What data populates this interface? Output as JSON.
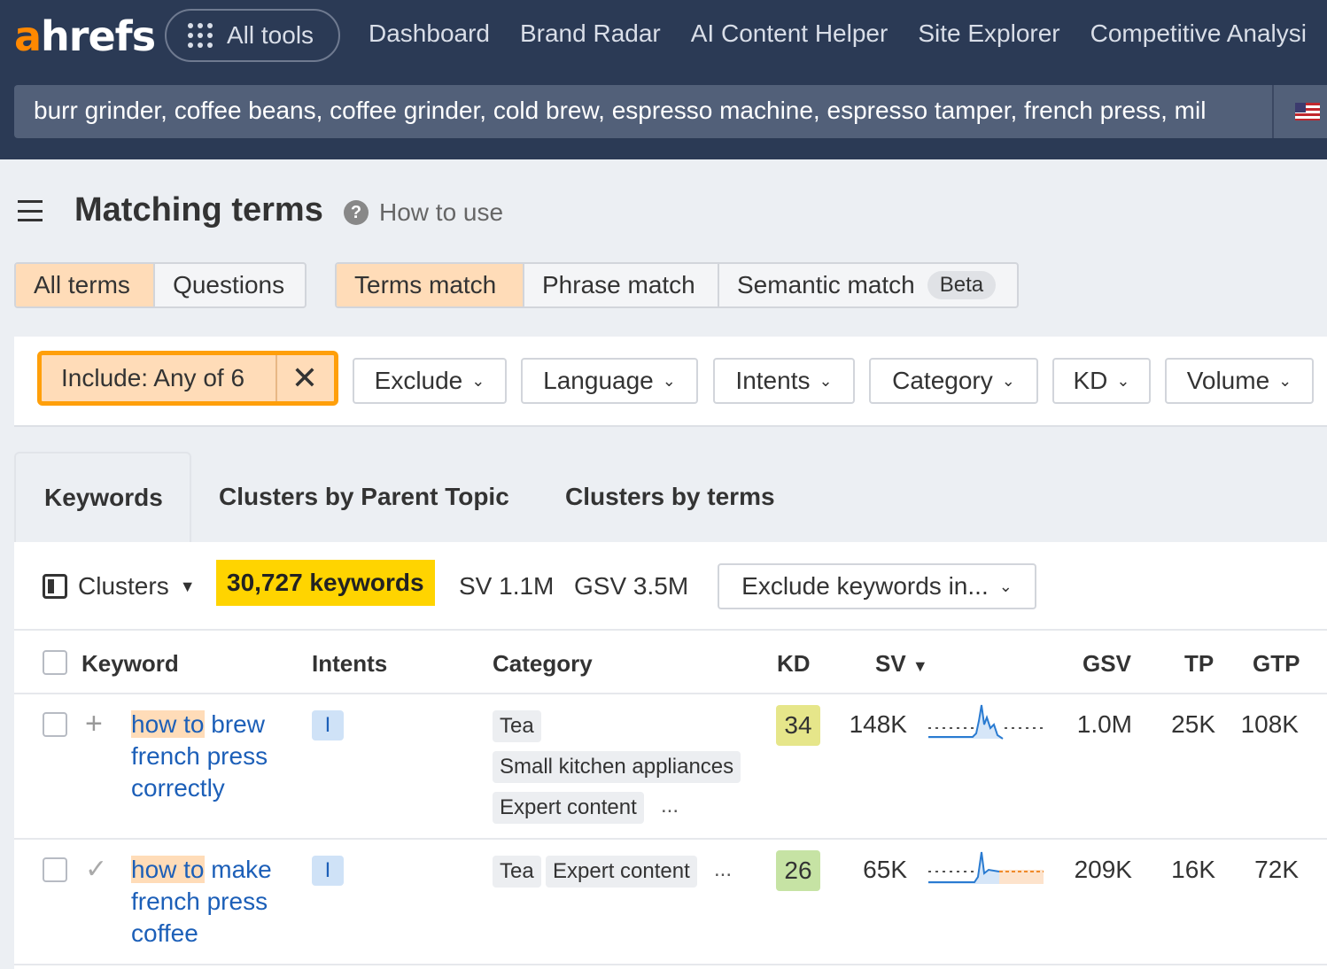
{
  "nav": {
    "logo_a": "a",
    "logo_rest": "hrefs",
    "all_tools": "All tools",
    "links": [
      "Dashboard",
      "Brand Radar",
      "AI Content Helper",
      "Site Explorer",
      "Competitive Analysi"
    ]
  },
  "search": {
    "query": "burr grinder, coffee beans, coffee grinder, cold brew, espresso machine, espresso tamper, french press, mil"
  },
  "page": {
    "title": "Matching terms",
    "help": "How to use"
  },
  "segments": {
    "scope": [
      {
        "label": "All terms",
        "active": true
      },
      {
        "label": "Questions",
        "active": false
      }
    ],
    "match": [
      {
        "label": "Terms match",
        "active": true
      },
      {
        "label": "Phrase match",
        "active": false
      },
      {
        "label": "Semantic match",
        "active": false,
        "badge": "Beta"
      }
    ]
  },
  "filters": {
    "include": "Include: Any of 6",
    "dropdowns": [
      "Exclude",
      "Language",
      "Intents",
      "Category",
      "KD",
      "Volume"
    ]
  },
  "tabs": [
    "Keywords",
    "Clusters by Parent Topic",
    "Clusters by terms"
  ],
  "toolbar": {
    "clusters": "Clusters",
    "keywords_count": "30,727 keywords",
    "sv": "SV 1.1M",
    "gsv": "GSV 3.5M",
    "exclude": "Exclude keywords in..."
  },
  "table": {
    "columns": {
      "keyword": "Keyword",
      "intents": "Intents",
      "category": "Category",
      "kd": "KD",
      "sv": "SV",
      "gsv": "GSV",
      "tp": "TP",
      "gtp": "GTP"
    },
    "rows": [
      {
        "kw_hl": "how to",
        "kw_rest": " brew french press correctly",
        "intent": "I",
        "categories": [
          "Tea",
          "Small kitchen appliances",
          "Expert content"
        ],
        "more": "...",
        "kd": "34",
        "kd_color": "#e6e68a",
        "sv": "148K",
        "gsv": "1.0M",
        "tp": "25K",
        "gtp": "108K"
      },
      {
        "kw_hl": "how to",
        "kw_rest": " make french press coffee",
        "intent": "I",
        "categories": [
          "Tea",
          "Expert content"
        ],
        "more": "...",
        "kd": "26",
        "kd_color": "#c6e3a4",
        "sv": "65K",
        "gsv": "209K",
        "tp": "16K",
        "gtp": "72K"
      }
    ]
  }
}
